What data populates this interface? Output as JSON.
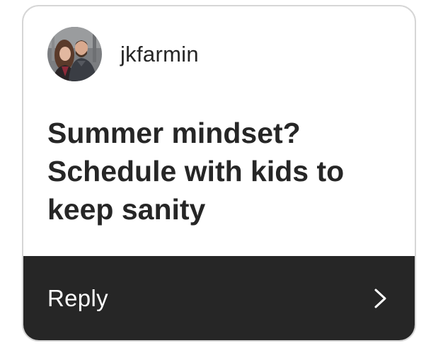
{
  "post": {
    "username": "jkfarmin",
    "avatar_icon": "profile-photo-avatar",
    "message": "Summer mindset? Schedule with kids to keep sanity"
  },
  "reply": {
    "label": "Reply",
    "icon": "chevron-right-icon"
  },
  "colors": {
    "text": "#262626",
    "reply_bar": "#262626",
    "reply_text": "#ffffff",
    "card_border": "#d6d6d6",
    "background": "#ffffff"
  }
}
